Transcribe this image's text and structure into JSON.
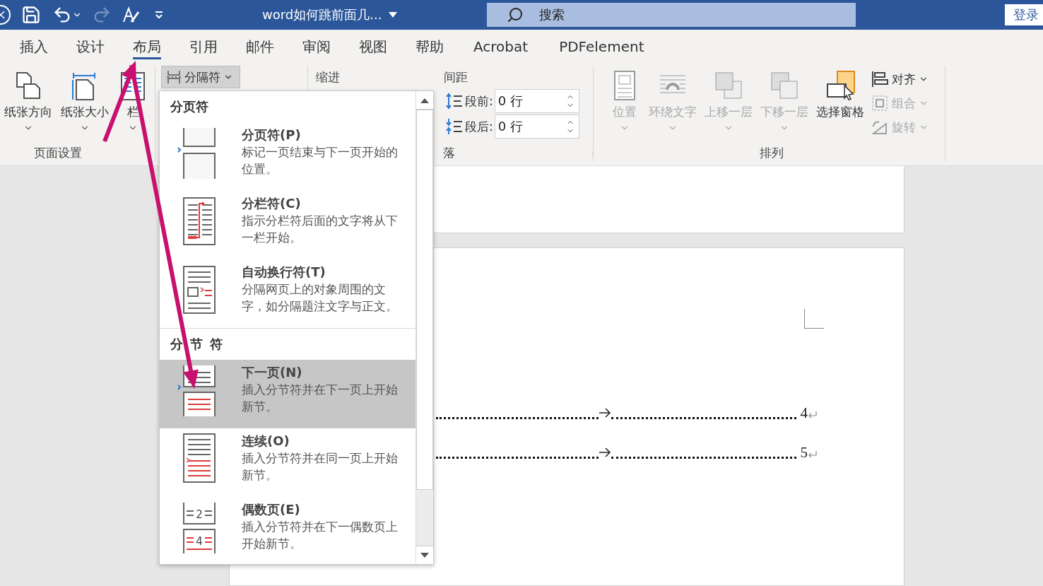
{
  "title_bar": {
    "title": "word如何跳前面几...",
    "search": {
      "placeholder": "搜索"
    },
    "login": "登录"
  },
  "tabs": [
    {
      "label": "插入",
      "selected": false
    },
    {
      "label": "设计",
      "selected": false
    },
    {
      "label": "布局",
      "selected": true
    },
    {
      "label": "引用",
      "selected": false
    },
    {
      "label": "邮件",
      "selected": false
    },
    {
      "label": "审阅",
      "selected": false
    },
    {
      "label": "视图",
      "selected": false
    },
    {
      "label": "帮助",
      "selected": false
    },
    {
      "label": "Acrobat",
      "selected": false
    },
    {
      "label": "PDFelement",
      "selected": false
    }
  ],
  "ribbon": {
    "page_setup": {
      "label": "页面设置",
      "buttons": [
        {
          "kind": "orientation",
          "label": "纸张方向"
        },
        {
          "kind": "size",
          "label": "纸张大小"
        },
        {
          "kind": "columns",
          "label": "栏"
        }
      ],
      "breaks_button": "分隔符"
    },
    "paragraph": {
      "indent_label": "缩进",
      "spacing_label": "间距",
      "fields": [
        {
          "kind": "before",
          "label": "段前:",
          "value": "0 行"
        },
        {
          "kind": "after",
          "label": "段后:",
          "value": "0 行"
        }
      ],
      "label": "落"
    },
    "arrange": {
      "label": "排列",
      "large": [
        {
          "kind": "position",
          "label": "位置",
          "disabled": true
        },
        {
          "kind": "wrap",
          "label": "环绕文字",
          "disabled": true
        },
        {
          "kind": "forward",
          "label": "上移一层",
          "disabled": true
        },
        {
          "kind": "backward",
          "label": "下移一层",
          "disabled": true
        },
        {
          "kind": "pane",
          "label": "选择窗格",
          "disabled": false
        }
      ],
      "small": [
        {
          "kind": "align",
          "label": "对齐",
          "disabled": false
        },
        {
          "kind": "group",
          "label": "组合",
          "disabled": true
        },
        {
          "kind": "rotate",
          "label": "旋转",
          "disabled": true
        }
      ]
    }
  },
  "breaks_menu": {
    "sections": [
      {
        "heading": "分页符",
        "items": [
          {
            "kind": "page",
            "title": "分页符(P)",
            "description": "标记一页结束与下一页开始的位置。",
            "selected": false
          },
          {
            "kind": "column",
            "title": "分栏符(C)",
            "description": "指示分栏符后面的文字将从下一栏开始。",
            "selected": false
          },
          {
            "kind": "wrap",
            "title": "自动换行符(T)",
            "description": "分隔网页上的对象周围的文字，如分隔题注文字与正文。",
            "selected": false
          }
        ]
      },
      {
        "heading": "分节符",
        "items": [
          {
            "kind": "next_page",
            "title": "下一页(N)",
            "description": "插入分节符并在下一页上开始新节。",
            "selected": true
          },
          {
            "kind": "continuous",
            "title": "连续(O)",
            "description": "插入分节符并在同一页上开始新节。",
            "selected": false
          },
          {
            "kind": "even_page",
            "title": "偶数页(E)",
            "description": "插入分节符并在下一偶数页上开始新节。",
            "icon_labels": [
              "2",
              "4"
            ],
            "selected": false
          }
        ]
      }
    ]
  },
  "document": {
    "toc_lines": [
      {
        "page": "4"
      },
      {
        "page": "5"
      }
    ]
  }
}
